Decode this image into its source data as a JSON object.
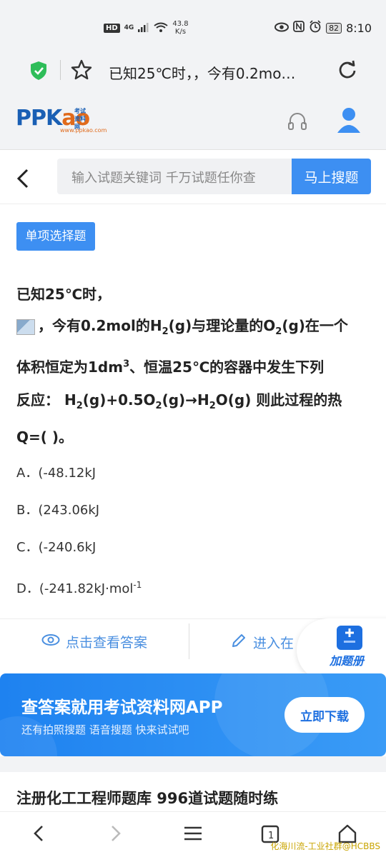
{
  "status_bar": {
    "network": "HD",
    "signal": "4G",
    "speed_value": "43.8",
    "speed_unit": "K/s",
    "battery": "82",
    "time": "8:10"
  },
  "browser": {
    "page_title": "已知25℃时，，今有0.2mo…"
  },
  "header": {
    "logo_text_1": "PP",
    "logo_text_2": "K",
    "logo_text_3": "ao",
    "logo_sub": "考试资料网",
    "logo_url": "www.ppkao.com"
  },
  "search": {
    "placeholder": "输入试题关键词 千万试题任你查",
    "button": "马上搜题"
  },
  "question": {
    "type_tag": "单项选择题",
    "line1": "已知25℃时，",
    "line2_a": "，今有0.2mol的H",
    "line2_b": "2",
    "line2_c": "(g)与理论量的O",
    "line2_d": "2",
    "line2_e": "(g)在一个",
    "line3_a": "体积恒定为1dm",
    "line3_b": "3",
    "line3_c": "、恒温25℃的容器中发生下列",
    "line4_a": "反应： H",
    "line4_b": "2",
    "line4_c": "(g)+0.5O",
    "line4_d": "2",
    "line4_e": "(g)→H",
    "line4_f": "2",
    "line4_g": "O(g) 则此过程的热",
    "line5": "Q=( )。",
    "options": [
      "A．(-48.12kJ",
      "B．(243.06kJ",
      "C．(-240.6kJ",
      "D．(-241.82kJ·mol"
    ],
    "option_d_sup": "-1"
  },
  "actions": {
    "view_answer": "点击查看答案",
    "enter_practice": "进入在",
    "add_book": "加题册"
  },
  "banner": {
    "title": "查答案就用考试资料网APP",
    "subtitle": "还有拍照搜题 语音搜题 快来试试吧",
    "download": "立即下载"
  },
  "bank": {
    "title": "注册化工工程师题库 996道试题随时练"
  },
  "watermark": "化海川流-工业社群@HCBBS",
  "colors": {
    "accent": "#3d8ff2",
    "link": "#4a8fe0",
    "banner": "#1e82f0"
  }
}
